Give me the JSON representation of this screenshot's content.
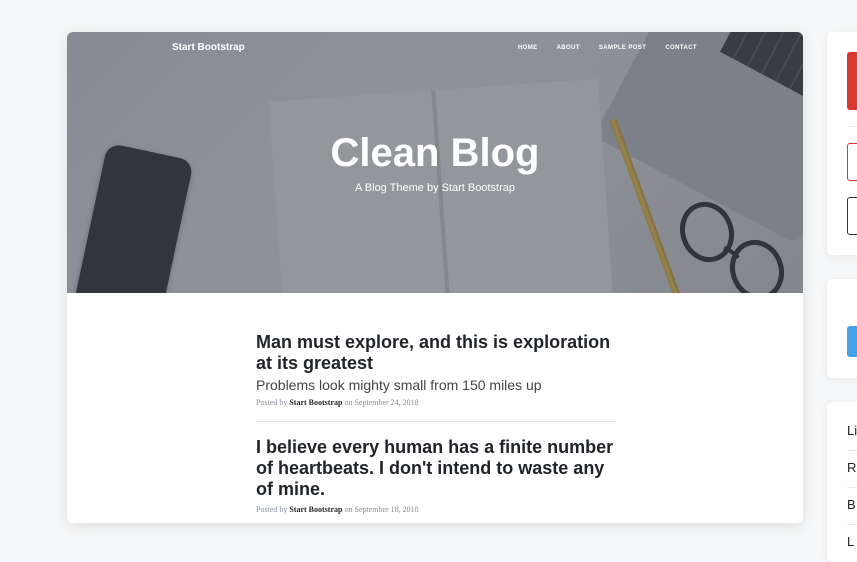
{
  "nav": {
    "brand": "Start Bootstrap",
    "links": [
      "HOME",
      "ABOUT",
      "SAMPLE POST",
      "CONTACT"
    ]
  },
  "hero": {
    "title": "Clean Blog",
    "subtitle": "A Blog Theme by Start Bootstrap"
  },
  "posts": [
    {
      "title": "Man must explore, and this is exploration at its greatest",
      "subtitle": "Problems look mighty small from 150 miles up",
      "meta_prefix": "Posted by",
      "author": "Start Bootstrap",
      "meta_on": "on",
      "date": "September 24, 2018"
    },
    {
      "title": "I believe every human has a finite number of heartbeats. I don't intend to waste any of mine.",
      "subtitle": "",
      "meta_prefix": "Posted by",
      "author": "Start Bootstrap",
      "meta_on": "on",
      "date": "September 18, 2018"
    }
  ],
  "sidebar": {
    "list_items": [
      "Li",
      "R",
      "B",
      "L"
    ]
  },
  "colors": {
    "accent_red": "#d9372f",
    "accent_blue": "#43a3e6"
  }
}
